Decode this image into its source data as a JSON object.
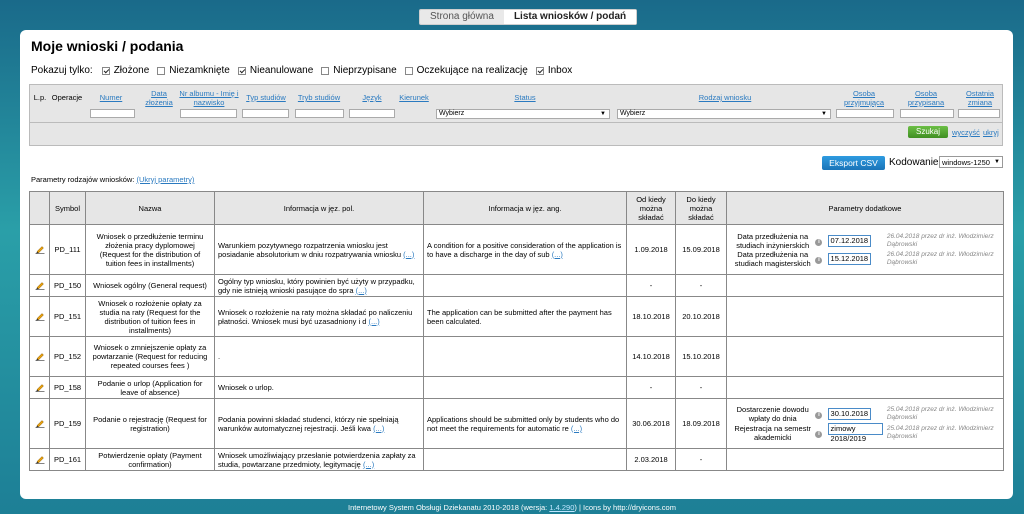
{
  "breadcrumb": {
    "home": "Strona główna",
    "current": "Lista wniosków / podań"
  },
  "page_title": "Moje wnioski / podania",
  "filters": {
    "label": "Pokazuj tylko:",
    "items": [
      {
        "label": "Złożone",
        "checked": true
      },
      {
        "label": "Niezamknięte",
        "checked": false
      },
      {
        "label": "Nieanulowane",
        "checked": true
      },
      {
        "label": "Nieprzypisane",
        "checked": false
      },
      {
        "label": "Oczekujące na realizację",
        "checked": false
      },
      {
        "label": "Inbox",
        "checked": true
      }
    ]
  },
  "grid": {
    "lp": "L.p.",
    "operacje": "Operacje",
    "numer": "Numer",
    "data_zlozenia": "Data złożenia",
    "nr_albumu": "Nr albumu - Imię i nazwisko",
    "typ_studiow": "Typ studiów",
    "tryb_studiow": "Tryb studiów",
    "jezyk": "Język",
    "kierunek": "Kierunek",
    "status": "Status",
    "rodzaj": "Rodzaj wniosku",
    "osoba_przyjmujaca": "Osoba przyjmująca",
    "osoba_przypisana": "Osoba przypisana",
    "ostatnia_zmiana": "Ostatnia zmiana",
    "status_select": "Wybierz",
    "rodzaj_select": "Wybierz",
    "search": "Szukaj",
    "clear": "wyczyść",
    "hide": "ukryj"
  },
  "export": {
    "button": "Eksport CSV",
    "encoding_label": "Kodowanie:",
    "encoding_value": "windows-1250"
  },
  "params": {
    "text": "Parametry rodzajów wniosków:",
    "link": "(Ukryj parametry)"
  },
  "table": {
    "headers": {
      "symbol": "Symbol",
      "nazwa": "Nazwa",
      "info_pl": "Informacja w jęz. pol.",
      "info_en": "Informacja w jęz. ang.",
      "od": "Od kiedy można składać",
      "do": "Do kiedy można składać",
      "params": "Parametry dodatkowe"
    },
    "rows": [
      {
        "symbol": "PD_111",
        "nazwa": "Wniosek o przedłużenie terminu złożenia pracy dyplomowej (Request for the distribution of tuition fees in installments)",
        "pl": "Warunkiem pozytywnego rozpatrzenia wniosku jest posiadanie absolutorium w dniu rozpatrywania wniosku",
        "en": "A condition for a positive consideration of the application is to have a discharge in the day of sub",
        "od": "1.09.2018",
        "do": "15.09.2018",
        "params": [
          {
            "label": "Data przedłużenia na studiach inżynierskich",
            "value": "07.12.2018",
            "note": "26.04.2018 przez dr inż. Włodzimierz Dąbrowski"
          },
          {
            "label": "Data przedłużenia na studiach magisterskich",
            "value": "15.12.2018",
            "note": "26.04.2018 przez dr inż. Włodzimierz Dąbrowski"
          }
        ]
      },
      {
        "symbol": "PD_150",
        "nazwa": "Wniosek ogólny (General request)",
        "pl": "Ogólny typ wniosku, który powinien być użyty w przypadku, gdy nie istnieją wnioski pasujące do spra",
        "en": "",
        "od": "-",
        "do": "-",
        "params": []
      },
      {
        "symbol": "PD_151",
        "nazwa": "Wniosek o rozłożenie opłaty za studia na raty (Request for the distribution of tuition fees in installments)",
        "pl": "Wniosek o rozłożenie na raty można składać po naliczeniu płatności. Wniosek musi być uzasadniony i d",
        "en": "The application can be submitted after the payment has been calculated.",
        "od": "18.10.2018",
        "do": "20.10.2018",
        "params": []
      },
      {
        "symbol": "PD_152",
        "nazwa": "Wniosek o zmniejszenie opłaty za powtarzanie (Request for reducing repeated courses fees )",
        "pl": ".",
        "en": "",
        "od": "14.10.2018",
        "do": "15.10.2018",
        "params": []
      },
      {
        "symbol": "PD_158",
        "nazwa": "Podanie o urlop (Application for leave of absence)",
        "pl": "Wniosek o urlop.",
        "en": "",
        "od": "-",
        "do": "-",
        "params": []
      },
      {
        "symbol": "PD_159",
        "nazwa": "Podanie o rejestrację (Request for registration)",
        "pl": "Podania powinni składać studenci, którzy nie spełniają warunków automatycznej rejestracji. Jeśli kwa",
        "en": "Applications should be submitted only by students who do not meet the requirements for automatic re",
        "od": "30.06.2018",
        "do": "18.09.2018",
        "params": [
          {
            "label": "Dostarczenie dowodu wpłaty do dnia",
            "value": "30.10.2018",
            "note": "25.04.2018 przez dr inż. Włodzimierz Dąbrowski"
          },
          {
            "label": "Rejestracja na semestr akademicki",
            "value": "zimowy 2018/2019",
            "note": "25.04.2018 przez dr inż. Włodzimierz Dąbrowski"
          }
        ]
      },
      {
        "symbol": "PD_161",
        "nazwa": "Potwierdzenie opłaty (Payment confirmation)",
        "pl": "Wniosek umożliwiający przesłanie potwierdzenia zapłaty za studia, powtarzane przedmioty, legitymację",
        "en": "",
        "od": "2.03.2018",
        "do": "-",
        "params": []
      }
    ],
    "more_link": "(...)"
  },
  "footer": {
    "text": "Internetowy System Obsługi Dziekanatu 2010-2018 (wersja:",
    "version": "1.4.290",
    "rest": ") | Icons by http://dryicons.com"
  }
}
